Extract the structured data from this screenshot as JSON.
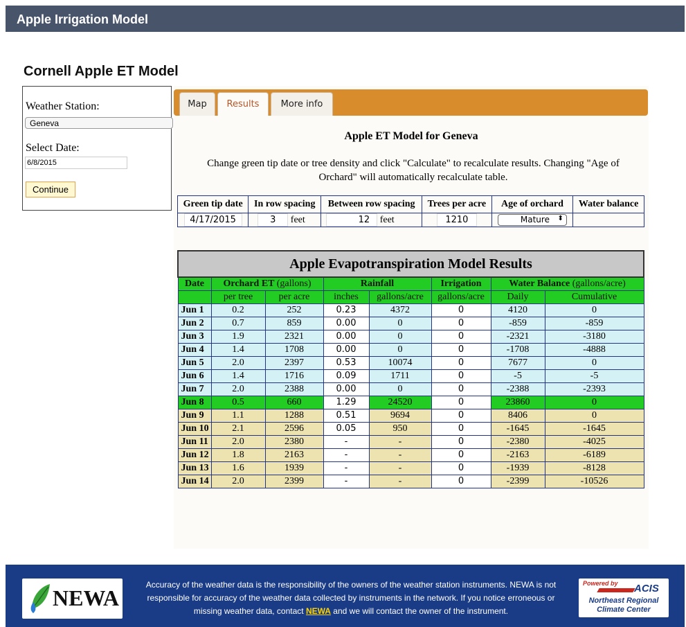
{
  "app": {
    "title": "Apple Irrigation Model",
    "page_title": "Cornell Apple ET Model"
  },
  "sidebar": {
    "station_label": "Weather Station:",
    "station_value": "Geneva",
    "date_label": "Select Date:",
    "date_value": "6/8/2015",
    "continue_label": "Continue"
  },
  "tabs": [
    {
      "label": "Map",
      "active": false
    },
    {
      "label": "Results",
      "active": true
    },
    {
      "label": "More info",
      "active": false
    }
  ],
  "results": {
    "title": "Apple ET Model for Geneva",
    "instructions": "Change green tip date or tree density and click \"Calculate\" to recalculate results. Changing \"Age of Orchard\" will automatically recalculate table."
  },
  "params": {
    "headers": [
      "Green tip date",
      "In row spacing",
      "Between row spacing",
      "Trees per acre",
      "Age of orchard",
      "Water balance"
    ],
    "green_tip": "4/17/2015",
    "in_row": "3",
    "between_row": "12",
    "unit": "feet",
    "trees_per_acre": "1210",
    "age": "Mature",
    "water_balance": ""
  },
  "table": {
    "banner": "Apple Evapotranspiration Model Results",
    "h_date": "Date",
    "h_orchard_bold": "Orchard ET",
    "h_orchard_unit": "(gallons)",
    "h_rain": "Rainfall",
    "h_irr": "Irrigation",
    "h_wb_bold": "Water Balance",
    "h_wb_unit": "(gallons/acre)",
    "subheaders": [
      "per tree",
      "per acre",
      "inches",
      "gallons/acre",
      "gallons/acre",
      "Daily",
      "Cumulative"
    ],
    "rows": [
      {
        "date": "Jun 1",
        "tree": "0.2",
        "acre": "252",
        "rain": "0.23",
        "rgal": "4372",
        "irr": "0",
        "daily": "4120",
        "cum": "0",
        "state": "past"
      },
      {
        "date": "Jun 2",
        "tree": "0.7",
        "acre": "859",
        "rain": "0.00",
        "rgal": "0",
        "irr": "0",
        "daily": "-859",
        "cum": "-859",
        "state": "past"
      },
      {
        "date": "Jun 3",
        "tree": "1.9",
        "acre": "2321",
        "rain": "0.00",
        "rgal": "0",
        "irr": "0",
        "daily": "-2321",
        "cum": "-3180",
        "state": "past"
      },
      {
        "date": "Jun 4",
        "tree": "1.4",
        "acre": "1708",
        "rain": "0.00",
        "rgal": "0",
        "irr": "0",
        "daily": "-1708",
        "cum": "-4888",
        "state": "past"
      },
      {
        "date": "Jun 5",
        "tree": "2.0",
        "acre": "2397",
        "rain": "0.53",
        "rgal": "10074",
        "irr": "0",
        "daily": "7677",
        "cum": "0",
        "state": "past"
      },
      {
        "date": "Jun 6",
        "tree": "1.4",
        "acre": "1716",
        "rain": "0.09",
        "rgal": "1711",
        "irr": "0",
        "daily": "-5",
        "cum": "-5",
        "state": "past"
      },
      {
        "date": "Jun 7",
        "tree": "2.0",
        "acre": "2388",
        "rain": "0.00",
        "rgal": "0",
        "irr": "0",
        "daily": "-2388",
        "cum": "-2393",
        "state": "past"
      },
      {
        "date": "Jun 8",
        "tree": "0.5",
        "acre": "660",
        "rain": "1.29",
        "rgal": "24520",
        "irr": "0",
        "daily": "23860",
        "cum": "0",
        "state": "today"
      },
      {
        "date": "Jun 9",
        "tree": "1.1",
        "acre": "1288",
        "rain": "0.51",
        "rgal": "9694",
        "irr": "0",
        "daily": "8406",
        "cum": "0",
        "state": "future"
      },
      {
        "date": "Jun 10",
        "tree": "2.1",
        "acre": "2596",
        "rain": "0.05",
        "rgal": "950",
        "irr": "0",
        "daily": "-1645",
        "cum": "-1645",
        "state": "future"
      },
      {
        "date": "Jun 11",
        "tree": "2.0",
        "acre": "2380",
        "rain": "-",
        "rgal": "-",
        "irr": "0",
        "daily": "-2380",
        "cum": "-4025",
        "state": "future"
      },
      {
        "date": "Jun 12",
        "tree": "1.8",
        "acre": "2163",
        "rain": "-",
        "rgal": "-",
        "irr": "0",
        "daily": "-2163",
        "cum": "-6189",
        "state": "future"
      },
      {
        "date": "Jun 13",
        "tree": "1.6",
        "acre": "1939",
        "rain": "-",
        "rgal": "-",
        "irr": "0",
        "daily": "-1939",
        "cum": "-8128",
        "state": "future"
      },
      {
        "date": "Jun 14",
        "tree": "2.0",
        "acre": "2399",
        "rain": "-",
        "rgal": "-",
        "irr": "0",
        "daily": "-2399",
        "cum": "-10526",
        "state": "future"
      }
    ]
  },
  "footer": {
    "logo_text": "NEWA",
    "text_before": "Accuracy of the weather data is the responsibility of the owners of the weather station instruments. NEWA is not responsible for accuracy of the weather data collected by instruments in the network. If you notice erroneous or missing weather data, contact ",
    "link": "NEWA",
    "text_after": " and we will contact the owner of the instrument.",
    "acis_powered": "Powered by",
    "acis_name": "ACIS",
    "acis_line1": "Northeast Regional",
    "acis_line2": "Climate Center"
  },
  "colors": {
    "header_bar": "#48546a",
    "tab_bar": "#d88c2c",
    "green_header": "#22cc22",
    "past_row": "#d4f2f5",
    "future_row": "#ece3b0",
    "footer": "#1a3b86"
  }
}
